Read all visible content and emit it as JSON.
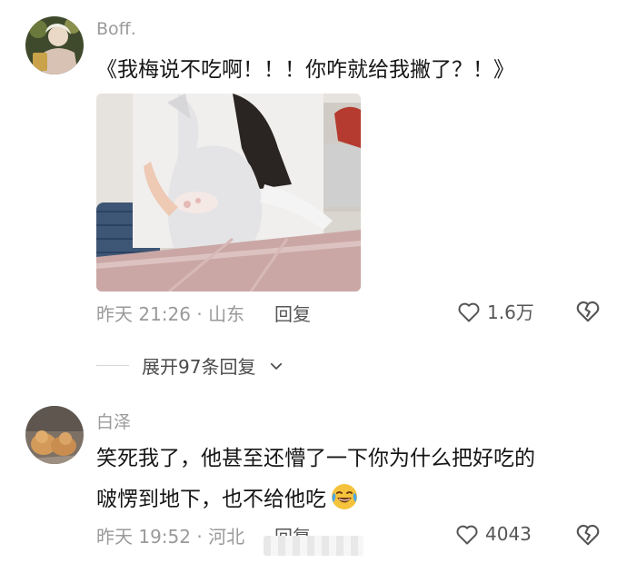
{
  "comments": [
    {
      "username": "Boff.",
      "text": "《我梅说不吃啊！！！你咋就给我撇了？！》",
      "meta": "昨天 21:26 · 山东",
      "reply_label": "回复",
      "like_count": "1.6万",
      "icons": [
        "heart-outline-icon",
        "broken-heart-icon"
      ]
    },
    {
      "username": "白泽",
      "text_line1": "笑死我了，他甚至还懵了一下你为什么把好吃的",
      "text_line2": "啵愣到地下，也不给他吃",
      "meta": "昨天 19:52 · 河北",
      "reply_label": "回复",
      "like_count": "4043",
      "icons": [
        "heart-outline-icon",
        "broken-heart-icon",
        "laughing-tears-emoji-icon"
      ]
    }
  ],
  "expand_replies": {
    "label": "展开97条回复",
    "icon": "chevron-down-icon"
  },
  "colors": {
    "text": "#161616",
    "muted": "#9a9a9a",
    "secondary": "#555555",
    "background": "#ffffff"
  }
}
